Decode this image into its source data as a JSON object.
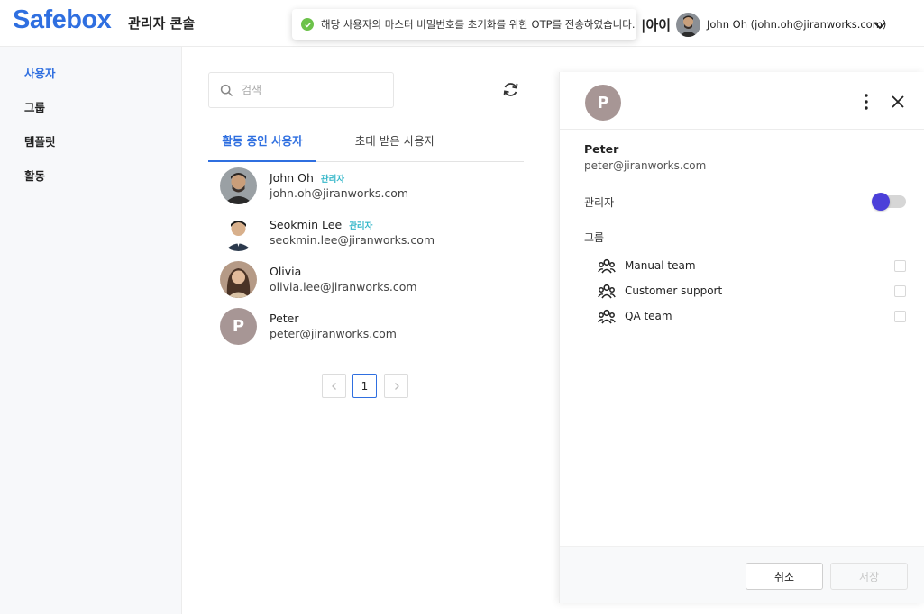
{
  "header": {
    "logo": "Safebox",
    "console_title": "관리자 콘솔",
    "toast_message": "해당 사용자의 마스터 비밀번호를 초기화를 위한 OTP를 전송하였습니다.",
    "partial_text": "|아이",
    "current_user": "John Oh  (john.oh@jiranworks.com)"
  },
  "sidebar": {
    "items": [
      {
        "label": "사용자",
        "active": true
      },
      {
        "label": "그룹",
        "active": false
      },
      {
        "label": "템플릿",
        "active": false
      },
      {
        "label": "활동",
        "active": false
      }
    ]
  },
  "search": {
    "placeholder": "검색",
    "value": ""
  },
  "tabs": [
    {
      "label": "활동 중인 사용자",
      "active": true
    },
    {
      "label": "초대 받은 사용자",
      "active": false
    }
  ],
  "users": [
    {
      "name": "John Oh",
      "email": "john.oh@jiranworks.com",
      "badge": "관리자",
      "avatar": "photo"
    },
    {
      "name": "Seokmin Lee",
      "email": "seokmin.lee@jiranworks.com",
      "badge": "관리자",
      "avatar": "photo"
    },
    {
      "name": "Olivia",
      "email": "olivia.lee@jiranworks.com",
      "badge": "",
      "avatar": "photo"
    },
    {
      "name": "Peter",
      "email": "peter@jiranworks.com",
      "badge": "",
      "avatar": "P"
    }
  ],
  "pagination": {
    "current_page": "1",
    "prev_icon": "chevron-left-icon",
    "next_icon": "chevron-right-icon"
  },
  "detail": {
    "avatar_letter": "P",
    "name": "Peter",
    "email": "peter@jiranworks.com",
    "admin_label": "관리자",
    "admin_toggle_on": true,
    "group_label": "그룹",
    "groups": [
      {
        "name": "Manual team",
        "checked": false
      },
      {
        "name": "Customer support",
        "checked": false
      },
      {
        "name": "QA team",
        "checked": false
      }
    ],
    "cancel_label": "취소",
    "save_label": "저장"
  },
  "colors": {
    "brand": "#2f6fe0",
    "admin_badge": "#35b7c9",
    "toggle": "#4b3fd9",
    "toast_success": "#6cc24a",
    "letter_avatar": "#a79695"
  }
}
